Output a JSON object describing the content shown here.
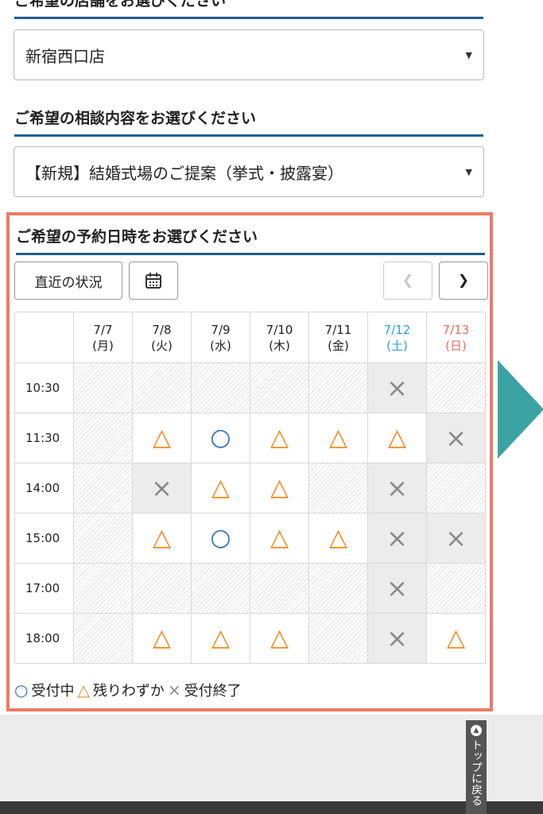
{
  "sections": {
    "store_heading": "ご希望の店舗をお選びください",
    "store_value": "新宿西口店",
    "consult_heading": "ご希望の相談内容をお選びください",
    "consult_value": "【新規】結婚式場のご提案（挙式・披露宴）",
    "datetime_heading": "ご希望の予約日時をお選びください"
  },
  "controls": {
    "recent_label": "直近の状況",
    "calendar_icon": "calendar-icon",
    "prev_icon": "chevron-left-icon",
    "next_icon": "chevron-right-icon"
  },
  "days": [
    {
      "date": "7/7",
      "dow": "(月)",
      "type": "weekday"
    },
    {
      "date": "7/8",
      "dow": "(火)",
      "type": "weekday"
    },
    {
      "date": "7/9",
      "dow": "(水)",
      "type": "weekday"
    },
    {
      "date": "7/10",
      "dow": "(木)",
      "type": "weekday"
    },
    {
      "date": "7/11",
      "dow": "(金)",
      "type": "weekday"
    },
    {
      "date": "7/12",
      "dow": "(土)",
      "type": "sat"
    },
    {
      "date": "7/13",
      "dow": "(日)",
      "type": "sun"
    }
  ],
  "times": [
    "10:30",
    "11:30",
    "14:00",
    "15:00",
    "17:00",
    "18:00"
  ],
  "availability": [
    [
      "none",
      "none",
      "none",
      "none",
      "none",
      "full",
      "none"
    ],
    [
      "none",
      "few",
      "open",
      "few",
      "few",
      "few",
      "full"
    ],
    [
      "none",
      "full",
      "few",
      "few",
      "none",
      "full",
      "none"
    ],
    [
      "none",
      "few",
      "open",
      "few",
      "few",
      "full",
      "full"
    ],
    [
      "none",
      "none",
      "none",
      "none",
      "none",
      "full",
      "none"
    ],
    [
      "none",
      "few",
      "few",
      "few",
      "none",
      "full",
      "few"
    ]
  ],
  "symbols": {
    "open": "○",
    "few": "△",
    "full": "×"
  },
  "legend": {
    "open_label": "受付中",
    "few_label": "残りわずか",
    "full_label": "受付終了"
  },
  "totop_label": "トップに戻る",
  "colors": {
    "panel_border": "#ef7a63",
    "heading_rule": "#1f5f8f",
    "open": "#2f72c4",
    "few": "#f28a1e",
    "full": "#8a8a8a",
    "saturday": "#29a3e0",
    "sunday": "#ec6b5e",
    "deco_arrow": "#3ca3a5"
  }
}
